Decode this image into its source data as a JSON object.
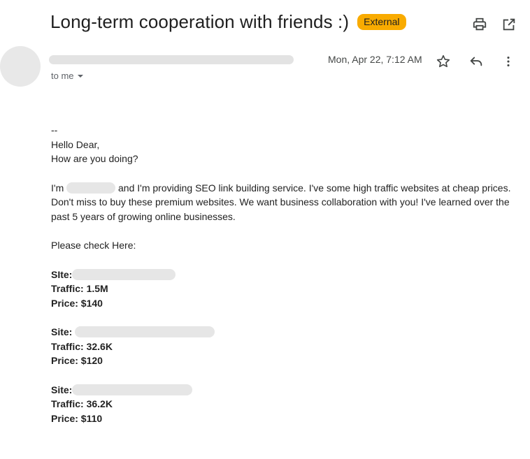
{
  "subject": {
    "title": "Long-term cooperation with friends :)",
    "badge": "External"
  },
  "toolbar": {
    "print_icon": "print-icon",
    "open_new_window_icon": "open-in-new-icon"
  },
  "header": {
    "date": "Mon, Apr 22, 7:12 AM",
    "to": "to me",
    "icons": [
      "star-icon",
      "reply-icon",
      "more-vert-icon"
    ]
  },
  "body": {
    "dash": "--",
    "greeting": "Hello Dear,",
    "question": "How are you doing?",
    "intro_prefix": "I'm",
    "intro_rest": "and I'm providing SEO link building service. I've some high traffic websites at cheap prices. Don't miss to buy these premium websites. We want business collaboration with you! I've learned over the past 5 years of growing online businesses.",
    "check": "Please check Here:",
    "sites": [
      {
        "site_label": "SIte:",
        "traffic": "Traffic: 1.5M",
        "price": "Price: $140"
      },
      {
        "site_label": "Site:",
        "traffic": "Traffic: 32.6K",
        "price": "Price: $120"
      },
      {
        "site_label": "Site:",
        "traffic": "Traffic: 36.2K",
        "price": "Price: $110"
      }
    ]
  }
}
